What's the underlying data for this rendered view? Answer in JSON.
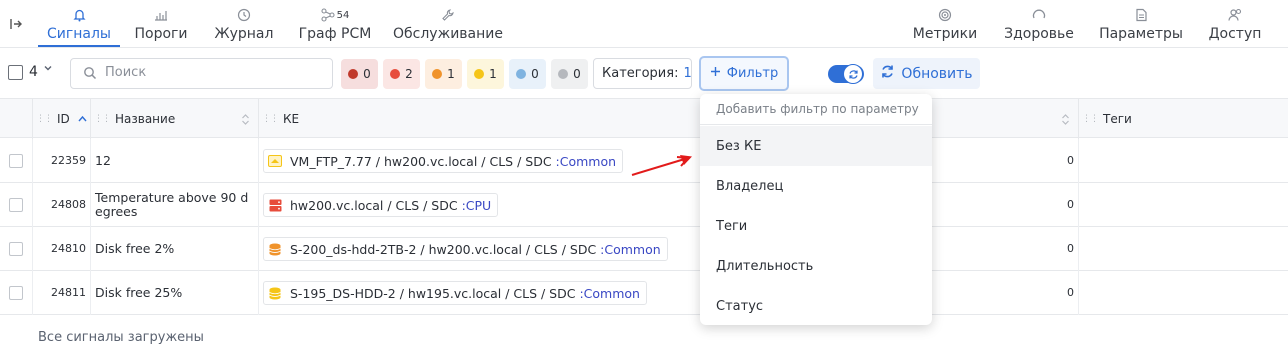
{
  "nav": {
    "tabs": [
      {
        "label": "Сигналы",
        "icon": "bell-icon",
        "active": true
      },
      {
        "label": "Пороги",
        "icon": "bar-chart-icon"
      },
      {
        "label": "Журнал",
        "icon": "history-icon"
      },
      {
        "label": "Граф РСМ",
        "icon": "graph-icon",
        "badge": "54"
      },
      {
        "label": "Обслуживание",
        "icon": "wrench-icon"
      }
    ],
    "right_tabs": [
      {
        "label": "Метрики",
        "icon": "gauge-icon"
      },
      {
        "label": "Здоровье",
        "icon": "circle-icon"
      },
      {
        "label": "Параметры",
        "icon": "document-icon"
      },
      {
        "label": "Доступ",
        "icon": "users-icon"
      }
    ]
  },
  "toolbar": {
    "selected_count": "4",
    "search_placeholder": "Поиск",
    "severity": [
      {
        "count": "0",
        "color": "#c0392b",
        "bg": "#f6dede"
      },
      {
        "count": "2",
        "color": "#e74c3c",
        "bg": "#fbe6e4"
      },
      {
        "count": "1",
        "color": "#f0932b",
        "bg": "#fdeee0"
      },
      {
        "count": "1",
        "color": "#f5c518",
        "bg": "#fdf6dc"
      },
      {
        "count": "0",
        "color": "#7fb3e0",
        "bg": "#e8f1fa"
      },
      {
        "count": "0",
        "color": "#b5b8bd",
        "bg": "#eff0f1"
      }
    ],
    "category_label": "Категория:",
    "category_value": "1",
    "filter_label": "Фильтр",
    "refresh_label": "Обновить"
  },
  "table": {
    "columns": {
      "id": "ID",
      "name": "Название",
      "ke": "КЕ",
      "tags": "Теги"
    },
    "rows": [
      {
        "id": "22359",
        "name": "12",
        "ke_path": "VM_FTP_7.77 / hw200.vc.local / CLS / SDC",
        "ke_type": ":Common",
        "icon": "vm-icon",
        "icon_color": "#f5c518",
        "value": "0"
      },
      {
        "id": "24808",
        "name": "Temperature above 90 degrees",
        "ke_path": "hw200.vc.local / CLS / SDC",
        "ke_type": ":CPU",
        "icon": "server-icon",
        "icon_color": "#e74c3c",
        "value": "0"
      },
      {
        "id": "24810",
        "name": "Disk free 2%",
        "ke_path": "S-200_ds-hdd-2TB-2 / hw200.vc.local / CLS / SDC",
        "ke_type": ":Common",
        "icon": "database-icon",
        "icon_color": "#f0932b",
        "value": "0"
      },
      {
        "id": "24811",
        "name": "Disk free 25%",
        "ke_path": "S-195_DS-HDD-2 / hw195.vc.local / CLS / SDC",
        "ke_type": ":Common",
        "icon": "database-icon",
        "icon_color": "#f5c518",
        "value": "0"
      }
    ]
  },
  "footer": {
    "status": "Все сигналы загружены"
  },
  "filter_dropdown": {
    "header": "Добавить фильтр по параметру",
    "items": [
      "Без КЕ",
      "Владелец",
      "Теги",
      "Длительность",
      "Статус"
    ]
  }
}
